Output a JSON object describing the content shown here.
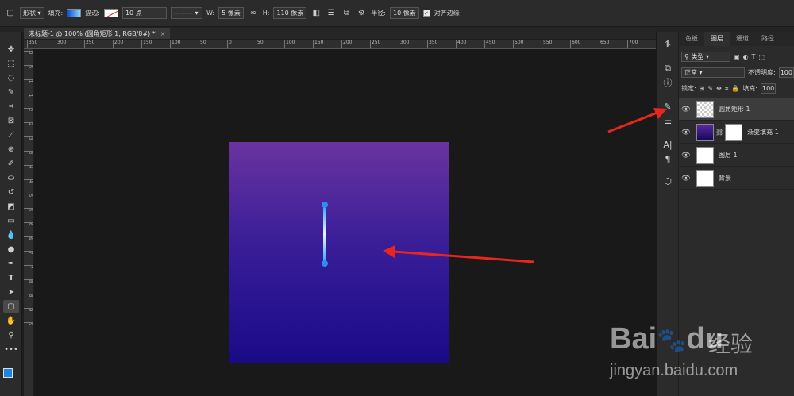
{
  "options_bar": {
    "mode": "形状",
    "fill_label": "填充:",
    "stroke_label": "描边:",
    "stroke_width": "10 点",
    "w_label": "W:",
    "w_value": "5 像素",
    "h_label": "H:",
    "h_value": "110 像素",
    "radius_label": "半径:",
    "radius_value": "10 像素",
    "align_edges": "对齐边缘"
  },
  "document": {
    "tab_title": "未标题-1 @ 100% (圆角矩形 1, RGB/8#) *",
    "close": "×"
  },
  "ruler_top": [
    "350",
    "300",
    "250",
    "200",
    "150",
    "100",
    "50",
    "0",
    "50",
    "100",
    "150",
    "200",
    "250",
    "300",
    "350",
    "400",
    "450",
    "500",
    "550",
    "600",
    "650",
    "700"
  ],
  "ruler_left": [
    "0",
    "5",
    "1",
    "1",
    "2",
    "2",
    "3",
    "3",
    "4",
    "4",
    "5",
    "5",
    "6",
    "6",
    "7",
    "7",
    "8",
    "8",
    "9",
    "9"
  ],
  "panel": {
    "tabs": [
      "色板",
      "图层",
      "通道",
      "路径"
    ],
    "active_tab": "图层",
    "filter": "类型",
    "blend_mode": "正常",
    "opacity_label": "不透明度:",
    "opacity_value": "100",
    "lock_label": "锁定:",
    "fill_label": "填充:",
    "fill_value": "100",
    "layers": [
      {
        "name": "圆角矩形 1",
        "active": true
      },
      {
        "name": "渐变填充 1",
        "active": false
      },
      {
        "name": "图层 1",
        "active": false
      },
      {
        "name": "背景",
        "active": false
      }
    ]
  },
  "watermark": {
    "logo": "Bai",
    "logo2": "du",
    "cn": "经验",
    "url": "jingyan.baidu.com"
  },
  "colors": {
    "accent": "#2f8cf0",
    "arrow": "#e8261e",
    "artboard_top": "#6a33a0",
    "artboard_bottom": "#1a0a88"
  }
}
